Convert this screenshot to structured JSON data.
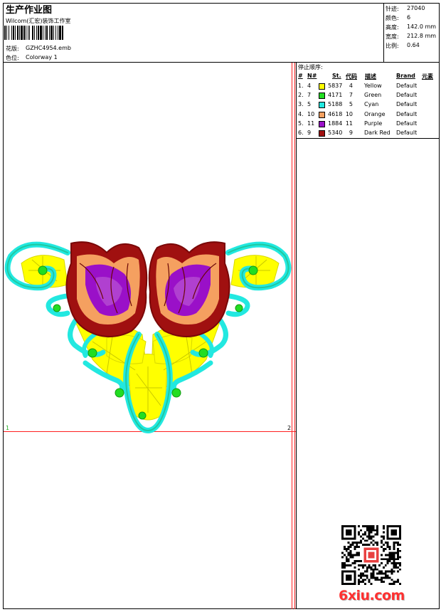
{
  "header": {
    "title": "生产作业图",
    "studio": "Wilcom(汇宏)装饰工作室",
    "design_label": "花版:",
    "design_value": "GZHC4954.emb",
    "colorway_label": "色位:",
    "colorway_value": "Colorway 1"
  },
  "specs": [
    {
      "label": "针迹:",
      "value": "27040"
    },
    {
      "label": "颜色:",
      "value": "6"
    },
    {
      "label": "高度:",
      "value": "142.0 mm"
    },
    {
      "label": "宽度:",
      "value": "212.8 mm"
    },
    {
      "label": "比例:",
      "value": "0.64"
    }
  ],
  "stop_sequence": {
    "title": "停止顺序:",
    "columns": [
      "#",
      "N#",
      "St.",
      "代码",
      "描述",
      "Brand",
      "元素"
    ],
    "rows": [
      {
        "num": "1.",
        "n": "4",
        "st": "5837",
        "code": "4",
        "desc": "Yellow",
        "brand": "Default",
        "color": "#ffff00"
      },
      {
        "num": "2.",
        "n": "7",
        "st": "4171",
        "code": "7",
        "desc": "Green",
        "brand": "Default",
        "color": "#22dd22"
      },
      {
        "num": "3.",
        "n": "5",
        "st": "5188",
        "code": "5",
        "desc": "Cyan",
        "brand": "Default",
        "color": "#22e8e0"
      },
      {
        "num": "4.",
        "n": "10",
        "st": "4618",
        "code": "10",
        "desc": "Orange",
        "brand": "Default",
        "color": "#f5a060"
      },
      {
        "num": "5.",
        "n": "11",
        "st": "1884",
        "code": "11",
        "desc": "Purple",
        "brand": "Default",
        "color": "#9a10c8"
      },
      {
        "num": "6.",
        "n": "9",
        "st": "5340",
        "code": "9",
        "desc": "Dark Red",
        "brand": "Default",
        "color": "#a01010"
      }
    ]
  },
  "markers": {
    "left": "1",
    "right": "2"
  },
  "logo": "6xiu.com",
  "colors": {
    "guide_red": "#ff2020",
    "yellow": "#ffff00",
    "cyan": "#22e8e0",
    "green": "#22dd22",
    "orange": "#f5a060",
    "purple": "#9a10c8",
    "dark_red": "#a01010"
  }
}
